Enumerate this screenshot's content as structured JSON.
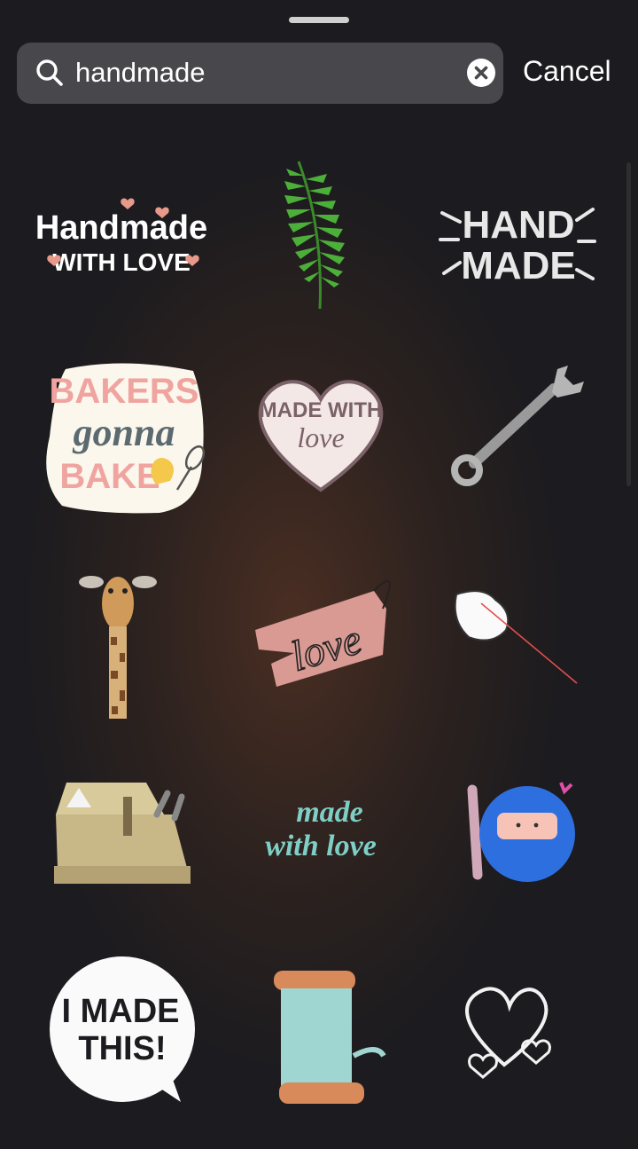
{
  "search": {
    "value": "handmade",
    "cancel_label": "Cancel"
  },
  "icons": {
    "search": "search-icon",
    "clear": "clear-icon"
  },
  "stickers": {
    "handmade_with_love": {
      "line1": "Handmade",
      "line2": "WITH LOVE"
    },
    "hand_made": {
      "line1": "HAND",
      "line2": "MADE"
    },
    "bakers_gonna_bake": {
      "line1": "BAKERS",
      "line2": "gonna",
      "line3": "BAKE"
    },
    "made_with_love_heart": {
      "line1": "MADE WITH",
      "line2": "love"
    },
    "love_ribbon": {
      "text": "love"
    },
    "made_with_love_script": {
      "line1": "made",
      "line2": "with love"
    },
    "i_made_this": {
      "line1": "I MADE",
      "line2": "THIS!"
    }
  }
}
